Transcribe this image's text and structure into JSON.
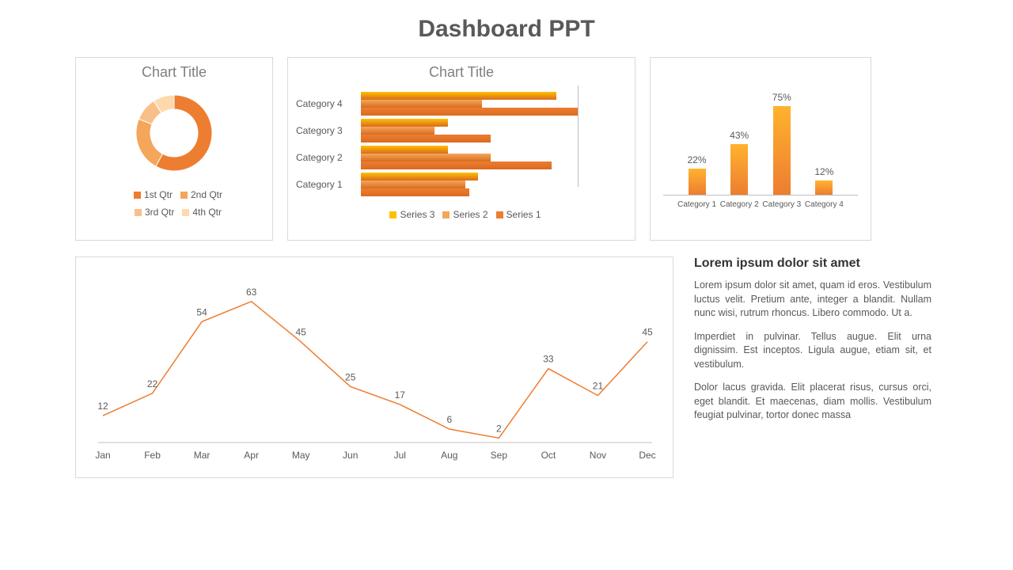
{
  "title": "Dashboard PPT",
  "chart_data": [
    {
      "type": "pie",
      "title": "Chart Title",
      "series": [
        {
          "name": "1st Qtr",
          "value": 58,
          "color": "#ed7d31"
        },
        {
          "name": "2nd Qtr",
          "value": 23,
          "color": "#f4a65a"
        },
        {
          "name": "3rd Qtr",
          "value": 10,
          "color": "#f8c089"
        },
        {
          "name": "4th Qtr",
          "value": 9,
          "color": "#ffd9ab"
        }
      ]
    },
    {
      "type": "bar",
      "orientation": "horizontal",
      "title": "Chart Title",
      "categories": [
        "Category 4",
        "Category 3",
        "Category 2",
        "Category 1"
      ],
      "series": [
        {
          "name": "Series 3",
          "color": "#ffc000",
          "values": [
            4.5,
            2.0,
            2.0,
            2.7
          ]
        },
        {
          "name": "Series 2",
          "color": "#f4a65a",
          "values": [
            2.8,
            1.7,
            3.0,
            2.4
          ]
        },
        {
          "name": "Series 1",
          "color": "#ed7d31",
          "values": [
            5.0,
            3.0,
            4.4,
            2.5
          ]
        }
      ],
      "xlim": [
        0,
        5
      ]
    },
    {
      "type": "bar",
      "categories": [
        "Category 1",
        "Category 2",
        "Category 3",
        "Category 4"
      ],
      "values": [
        22,
        43,
        75,
        12
      ],
      "value_suffix": "%",
      "color": "#f59b33",
      "ylim": [
        0,
        100
      ]
    },
    {
      "type": "line",
      "categories": [
        "Jan",
        "Feb",
        "Mar",
        "Apr",
        "May",
        "Jun",
        "Jul",
        "Aug",
        "Sep",
        "Oct",
        "Nov",
        "Dec"
      ],
      "values": [
        12,
        22,
        54,
        63,
        45,
        25,
        17,
        6,
        2,
        33,
        21,
        45
      ],
      "color": "#ed7d31",
      "ylim": [
        0,
        70
      ]
    }
  ],
  "text": {
    "heading": "Lorem ipsum dolor sit amet",
    "p1": "Lorem ipsum dolor sit amet, quam id eros. Vestibulum luctus velit. Pretium ante, integer a blandit. Nullam nunc wisi, rutrum rhoncus. Libero commodo. Ut a.",
    "p2": "Imperdiet in pulvinar. Tellus augue. Elit urna dignissim. Est inceptos. Ligula augue, etiam sit, et vestibulum.",
    "p3": "Dolor lacus gravida. Elit placerat risus, cursus orci, eget blandit. Et maecenas, diam mollis. Vestibulum feugiat pulvinar, tortor donec massa"
  }
}
